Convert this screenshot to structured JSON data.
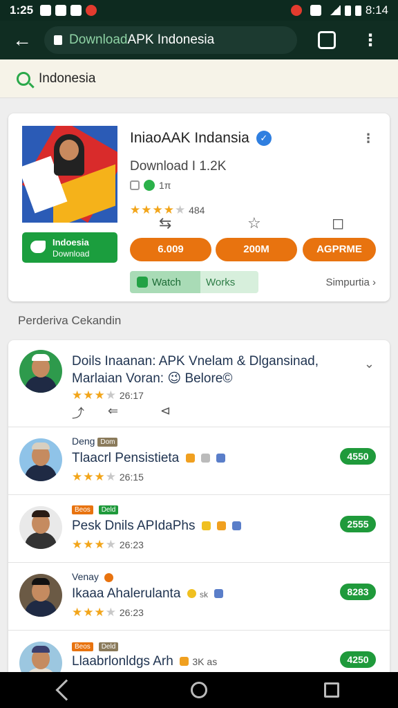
{
  "status": {
    "time": "1:25",
    "right_time": "8:14"
  },
  "browser": {
    "back_symbol": "←",
    "url_prefix": "Download",
    "url_rest": " APK Indonesia",
    "menu_symbol": "⋮"
  },
  "search": {
    "query": "Indonesia"
  },
  "app": {
    "title": "IniaoAAK Indansia",
    "verified_symbol": "✓",
    "kebab": "⋮",
    "download_line": "Download I 1.2K",
    "small_count": "1π",
    "rating_text": "484",
    "download_button": {
      "line1": "Indoesia",
      "line2": "Download"
    },
    "pills": [
      "6.009",
      "200M",
      "AGPRME"
    ],
    "tags": {
      "watch": "Watch",
      "works": "Works"
    },
    "see_more": "Simpurtia ›",
    "action_icons": [
      "⇆",
      "☆",
      "◻"
    ],
    "colors": {
      "accent": "#e8730f",
      "green": "#1b9e3e",
      "verified": "#2f7fe0"
    }
  },
  "section_label": "Perderiva Cekandin",
  "reviews": [
    {
      "name": "Doils Inaanan: APK Vnelam & Dlgansinad,",
      "name2": "Marlaian Voran: 😉 Belore©",
      "rating": "26:17",
      "chevron": "⌄",
      "actions": [
        "⤴",
        "⇐",
        "⊲"
      ]
    },
    {
      "tag": "Deng",
      "tag2": "Dom",
      "name": "Tlaacrl Pensistieta",
      "rating": "26:15",
      "score": "4550"
    },
    {
      "tag": "Beos",
      "tag2": "Deld",
      "name": "Pesk Dnils APIdaPhs",
      "rating": "26:23",
      "score": "2555"
    },
    {
      "tag": "Venay",
      "name": "Ikaaa Ahalerulanta",
      "rating": "26:23",
      "score": "8283",
      "extra": "sk"
    },
    {
      "tag": "Beos",
      "tag2": "Deld",
      "name": "Llaabrlonldgs Arh",
      "rating": "",
      "score": "4250",
      "extra": "3K as"
    }
  ]
}
